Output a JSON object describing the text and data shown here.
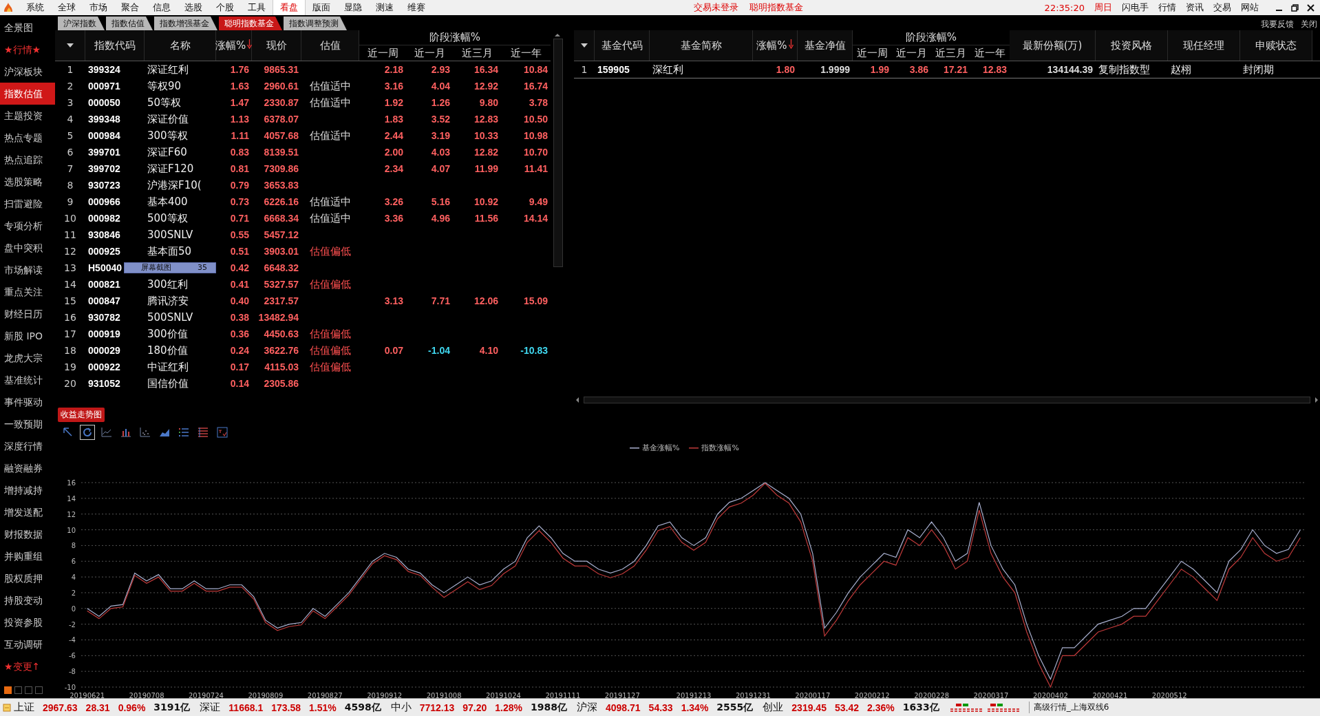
{
  "menu_bar": {
    "items": [
      {
        "label": "系统",
        "selected": false
      },
      {
        "label": "全球",
        "selected": false
      },
      {
        "label": "市场",
        "selected": false
      },
      {
        "label": "聚合",
        "selected": false
      },
      {
        "label": "信息",
        "selected": false
      },
      {
        "label": "选股",
        "selected": false
      },
      {
        "label": "个股",
        "selected": false
      },
      {
        "label": "工具",
        "selected": false
      },
      {
        "label": "看盘",
        "selected": true
      },
      {
        "label": "版面",
        "selected": false
      },
      {
        "label": "显隐",
        "selected": false
      },
      {
        "label": "测速",
        "selected": false
      },
      {
        "label": "维赛",
        "selected": false
      }
    ],
    "status": [
      "交易未登录",
      "聪明指数基金"
    ],
    "clock": "22:35:20",
    "weekday": "周日",
    "links": [
      "闪电手",
      "行情",
      "资讯",
      "交易",
      "网站"
    ]
  },
  "sidebar": {
    "items": [
      {
        "label": "全景图",
        "selected": false,
        "accent": false
      },
      {
        "label": "★行情★",
        "selected": false,
        "accent": true
      },
      {
        "label": "沪深板块",
        "selected": false,
        "accent": false
      },
      {
        "label": "指数估值",
        "selected": true,
        "accent": false
      },
      {
        "label": "主题投资",
        "selected": false,
        "accent": false
      },
      {
        "label": "热点专题",
        "selected": false,
        "accent": false
      },
      {
        "label": "热点追踪",
        "selected": false,
        "accent": false
      },
      {
        "label": "选股策略",
        "selected": false,
        "accent": false
      },
      {
        "label": "扫雷避险",
        "selected": false,
        "accent": false
      },
      {
        "label": "专项分析",
        "selected": false,
        "accent": false
      },
      {
        "label": "盘中突积",
        "selected": false,
        "accent": false
      },
      {
        "label": "市场解读",
        "selected": false,
        "accent": false
      },
      {
        "label": "重点关注",
        "selected": false,
        "accent": false
      },
      {
        "label": "财经日历",
        "selected": false,
        "accent": false
      },
      {
        "label": "新股 IPO",
        "selected": false,
        "accent": false
      },
      {
        "label": "龙虎大宗",
        "selected": false,
        "accent": false
      },
      {
        "label": "基准统计",
        "selected": false,
        "accent": false
      },
      {
        "label": "事件驱动",
        "selected": false,
        "accent": false
      },
      {
        "label": "一致预期",
        "selected": false,
        "accent": false
      },
      {
        "label": "深度行情",
        "selected": false,
        "accent": false
      },
      {
        "label": "融资融券",
        "selected": false,
        "accent": false
      },
      {
        "label": "增持减持",
        "selected": false,
        "accent": false
      },
      {
        "label": "增发送配",
        "selected": false,
        "accent": false
      },
      {
        "label": "财报数据",
        "selected": false,
        "accent": false
      },
      {
        "label": "并购重组",
        "selected": false,
        "accent": false
      },
      {
        "label": "股权质押",
        "selected": false,
        "accent": false
      },
      {
        "label": "持股变动",
        "selected": false,
        "accent": false
      },
      {
        "label": "投资参股",
        "selected": false,
        "accent": false
      },
      {
        "label": "互动调研",
        "selected": false,
        "accent": false
      },
      {
        "label": "★变更↑",
        "selected": false,
        "accent": true
      }
    ]
  },
  "tabs": [
    {
      "label": "沪深指数",
      "selected": false
    },
    {
      "label": "指数估值",
      "selected": false
    },
    {
      "label": "指数增强基金",
      "selected": false
    },
    {
      "label": "聪明指数基金",
      "selected": true
    },
    {
      "label": "指数调整预测",
      "selected": false
    }
  ],
  "top_links": [
    "我要反馈",
    "关闭"
  ],
  "index_table": {
    "columns": [
      {
        "label": "指数代码",
        "sorted": false
      },
      {
        "label": "名称",
        "sorted": false
      },
      {
        "label": "涨幅%",
        "sorted": true
      },
      {
        "label": "现价",
        "sorted": false
      },
      {
        "label": "估值",
        "sorted": false
      }
    ],
    "group_header": "阶段涨幅%",
    "period_columns": [
      "近一周",
      "近一月",
      "近三月",
      "近一年"
    ],
    "rows": [
      {
        "no": "1",
        "code": "399324",
        "name": "深证红利",
        "change": "1.76",
        "price": "9865.31",
        "periods": [
          "2.18",
          "2.93",
          "16.34",
          "10.84"
        ]
      },
      {
        "no": "2",
        "code": "000971",
        "name": "等权90",
        "change": "1.63",
        "price": "2960.61",
        "valuation": "估值适中",
        "valuation_low": false,
        "periods": [
          "3.16",
          "4.04",
          "12.92",
          "16.74"
        ]
      },
      {
        "no": "3",
        "code": "000050",
        "name": "50等权",
        "change": "1.47",
        "price": "2330.87",
        "valuation": "估值适中",
        "valuation_low": false,
        "periods": [
          "1.92",
          "1.26",
          "9.80",
          "3.78"
        ]
      },
      {
        "no": "4",
        "code": "399348",
        "name": "深证价值",
        "change": "1.13",
        "price": "6378.07",
        "periods": [
          "1.83",
          "3.52",
          "12.83",
          "10.50"
        ]
      },
      {
        "no": "5",
        "code": "000984",
        "name": "300等权",
        "change": "1.11",
        "price": "4057.68",
        "valuation": "估值适中",
        "valuation_low": false,
        "periods": [
          "2.44",
          "3.19",
          "10.33",
          "10.98"
        ]
      },
      {
        "no": "6",
        "code": "399701",
        "name": "深证F60",
        "change": "0.83",
        "price": "8139.51",
        "periods": [
          "2.00",
          "4.03",
          "12.82",
          "10.70"
        ]
      },
      {
        "no": "7",
        "code": "399702",
        "name": "深证F120",
        "change": "0.81",
        "price": "7309.86",
        "periods": [
          "2.34",
          "4.07",
          "11.99",
          "11.41"
        ]
      },
      {
        "no": "8",
        "code": "930723",
        "name": "沪港深F10(",
        "change": "0.79",
        "price": "3653.83",
        "periods": []
      },
      {
        "no": "9",
        "code": "000966",
        "name": "基本400",
        "change": "0.73",
        "price": "6226.16",
        "valuation": "估值适中",
        "valuation_low": false,
        "periods": [
          "3.26",
          "5.16",
          "10.92",
          "9.49"
        ]
      },
      {
        "no": "10",
        "code": "000982",
        "name": "500等权",
        "change": "0.71",
        "price": "6668.34",
        "valuation": "估值适中",
        "valuation_low": false,
        "periods": [
          "3.36",
          "4.96",
          "11.56",
          "14.14"
        ]
      },
      {
        "no": "11",
        "code": "930846",
        "name": "300SNLV",
        "change": "0.55",
        "price": "5457.12",
        "periods": []
      },
      {
        "no": "12",
        "code": "000925",
        "name": "基本面50",
        "change": "0.51",
        "price": "3903.01",
        "valuation": "估值偏低",
        "valuation_low": true,
        "periods": []
      },
      {
        "no": "13",
        "code": "H50040",
        "change": "0.42",
        "price": "6648.32",
        "periods": []
      },
      {
        "no": "14",
        "code": "000821",
        "name": "300红利",
        "change": "0.41",
        "price": "5327.57",
        "valuation": "估值偏低",
        "valuation_low": true,
        "periods": []
      },
      {
        "no": "15",
        "code": "000847",
        "name": "腾讯济安",
        "change": "0.40",
        "price": "2317.57",
        "periods": [
          "3.13",
          "7.71",
          "12.06",
          "15.09"
        ]
      },
      {
        "no": "16",
        "code": "930782",
        "name": "500SNLV",
        "change": "0.38",
        "price": "13482.94",
        "periods": []
      },
      {
        "no": "17",
        "code": "000919",
        "name": "300价值",
        "change": "0.36",
        "price": "4450.63",
        "valuation": "估值偏低",
        "valuation_low": true,
        "periods": []
      },
      {
        "no": "18",
        "code": "000029",
        "name": "180价值",
        "change": "0.24",
        "price": "3622.76",
        "valuation": "估值偏低",
        "valuation_low": true,
        "periods": [
          "0.07",
          "-1.04",
          "4.10",
          "-10.83"
        ]
      },
      {
        "no": "19",
        "code": "000922",
        "name": "中证红利",
        "change": "0.17",
        "price": "4115.03",
        "valuation": "估值偏低",
        "valuation_low": true,
        "periods": []
      },
      {
        "no": "20",
        "code": "931052",
        "name": "国信价值",
        "change": "0.14",
        "price": "2305.86",
        "periods": []
      }
    ]
  },
  "tooltip": {
    "label": "屏幕截图",
    "value": "35"
  },
  "fund_table": {
    "columns": [
      {
        "label": "基金代码",
        "sorted": false
      },
      {
        "label": "基金简称",
        "sorted": false
      },
      {
        "label": "涨幅%",
        "sorted": true
      },
      {
        "label": "基金净值",
        "sorted": false
      }
    ],
    "group_header": "阶段涨幅%",
    "period_columns": [
      "近一周",
      "近一月",
      "近三月",
      "近一年"
    ],
    "extra_columns": [
      "最新份额(万)",
      "投资风格",
      "现任经理",
      "申赎状态"
    ],
    "rows": [
      {
        "no": "1",
        "code": "159905",
        "name": "深红利",
        "change": "1.80",
        "nav": "1.9999",
        "periods": [
          "1.99",
          "3.86",
          "17.21",
          "12.83"
        ],
        "shares": "134144.39",
        "style": "复制指数型",
        "manager": "赵栩",
        "status": "封闭期"
      }
    ]
  },
  "chart_panel": {
    "title": "收益走势图",
    "tools": [
      {
        "kind": "pointer",
        "selected": false
      },
      {
        "kind": "refresh",
        "selected": true
      },
      {
        "kind": "line",
        "selected": false
      },
      {
        "kind": "bar",
        "selected": false
      },
      {
        "kind": "scatter",
        "selected": false
      },
      {
        "kind": "area",
        "selected": false
      },
      {
        "kind": "list",
        "selected": false
      },
      {
        "kind": "table",
        "selected": false
      },
      {
        "kind": "check",
        "selected": false
      }
    ],
    "pages": [
      {
        "selected": true
      },
      {
        "selected": false
      },
      {
        "selected": false
      },
      {
        "selected": false
      }
    ],
    "chart_data": {
      "type": "line",
      "categories": [
        "20190621",
        null,
        null,
        null,
        null,
        "20190708",
        null,
        null,
        null,
        null,
        "20190724",
        null,
        null,
        null,
        null,
        "20190809",
        null,
        null,
        null,
        null,
        "20190827",
        null,
        null,
        null,
        null,
        "20190912",
        null,
        null,
        null,
        null,
        "20191008",
        null,
        null,
        null,
        null,
        "20191024",
        null,
        null,
        null,
        null,
        "20191111",
        null,
        null,
        null,
        null,
        "20191127",
        null,
        null,
        null,
        null,
        null,
        "20191213",
        null,
        null,
        null,
        null,
        "20191231",
        null,
        null,
        null,
        null,
        "20200117",
        null,
        null,
        null,
        null,
        "20200212",
        null,
        null,
        null,
        null,
        "20200228",
        null,
        null,
        null,
        null,
        "20200317",
        null,
        null,
        null,
        null,
        "20200402",
        null,
        null,
        null,
        null,
        "20200421",
        null,
        null,
        null,
        null,
        "20200512",
        null,
        null,
        null,
        null,
        null,
        null,
        null,
        null,
        null,
        null,
        null
      ],
      "series": [
        {
          "name": "基金涨幅%",
          "color": "#a9b0d0",
          "values": [
            0,
            -1,
            0.3,
            0.5,
            4.5,
            3.5,
            4.3,
            2.5,
            2.5,
            3.5,
            2.5,
            2.5,
            3,
            3,
            1.5,
            -1.5,
            -2.5,
            -2,
            -1.8,
            0,
            -1,
            0.5,
            2,
            4,
            6,
            7,
            6.5,
            5,
            4.5,
            3,
            2,
            3,
            4,
            3,
            3.5,
            5,
            6,
            9,
            10.5,
            9,
            7,
            6,
            6,
            5,
            4.5,
            5,
            6,
            8,
            10.5,
            11,
            9,
            8,
            9,
            12,
            13.5,
            14,
            15,
            16,
            15,
            14,
            12,
            7,
            -2.5,
            -0.5,
            2,
            4,
            5.5,
            7,
            6.5,
            10,
            9,
            11,
            9,
            6,
            7,
            13.5,
            8,
            5,
            3,
            -2,
            -6,
            -9,
            -5,
            -5,
            -3.5,
            -2,
            -1.5,
            -1,
            0,
            0,
            2,
            4,
            6,
            5,
            3.5,
            2,
            6,
            7.5,
            10,
            8,
            7,
            7.5,
            10
          ]
        },
        {
          "name": "指数涨幅%",
          "color": "#c03a3a",
          "values": [
            -0.3,
            -1.3,
            0,
            0.2,
            4.2,
            3.2,
            4,
            2.2,
            2.2,
            3.2,
            2.2,
            2.2,
            2.7,
            2.7,
            1.2,
            -1.8,
            -2.8,
            -2.3,
            -2.1,
            -0.3,
            -1.3,
            0.2,
            1.7,
            3.7,
            5.7,
            6.7,
            6.2,
            4.7,
            4.2,
            2.7,
            1.4,
            2.4,
            3.4,
            2.4,
            2.9,
            4.4,
            5.4,
            8.4,
            9.9,
            8.4,
            6.4,
            5.4,
            5.4,
            4.4,
            3.9,
            4.4,
            5.4,
            7.4,
            9.9,
            10.4,
            8.4,
            7.4,
            8.4,
            11.4,
            12.9,
            13.4,
            14.4,
            15.9,
            14.4,
            13.4,
            11,
            6,
            -3.5,
            -1.5,
            1,
            3,
            4.5,
            6,
            5.5,
            9,
            8,
            10,
            8,
            5,
            6,
            12.5,
            7,
            4,
            2,
            -3,
            -7,
            -10,
            -6,
            -6,
            -4.5,
            -3,
            -2.5,
            -2,
            -1,
            -1,
            1,
            3,
            5,
            4,
            2.5,
            1,
            5,
            6.5,
            9,
            7,
            6,
            6.5,
            9
          ]
        }
      ],
      "ylim": [
        -10,
        16
      ],
      "grid": true,
      "yticks": [
        -10,
        -8,
        -6,
        -4,
        -2,
        0,
        2,
        4,
        6,
        8,
        10,
        12,
        14,
        16
      ]
    }
  },
  "status_bar": {
    "markets": [
      {
        "name": "上证",
        "value": "2967.63",
        "change": "28.31",
        "percent": "0.96%",
        "turnover": "3191亿"
      },
      {
        "name": "深证",
        "value": "11668.1",
        "change": "173.58",
        "percent": "1.51%",
        "turnover": "4598亿"
      },
      {
        "name": "中小",
        "value": "7712.13",
        "change": "97.20",
        "percent": "1.28%",
        "turnover": "1988亿"
      },
      {
        "name": "沪深",
        "value": "4098.71",
        "change": "54.33",
        "percent": "1.34%",
        "turnover": "2555亿"
      },
      {
        "name": "创业",
        "value": "2319.45",
        "change": "53.42",
        "percent": "2.36%",
        "turnover": "1633亿"
      }
    ],
    "feed": "高级行情_上海双线6"
  }
}
